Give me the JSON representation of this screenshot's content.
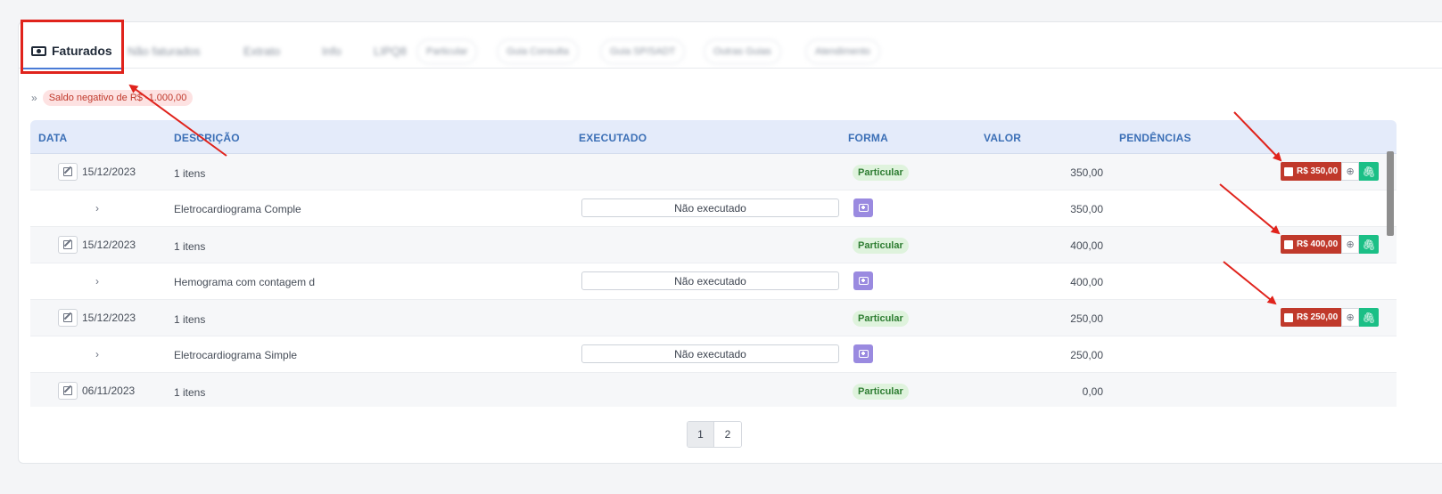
{
  "tabs": {
    "active_label": "Faturados",
    "others": [
      "Não faturados",
      "Extrato",
      "Info",
      "LIPQ8",
      "Particular",
      "Guia Consulta",
      "Guia SP/SADT",
      "Outras Guias",
      "Atendimento"
    ]
  },
  "saldo": {
    "prefix": "»",
    "text": "Saldo negativo de R$ -1.000,00"
  },
  "table": {
    "headers": {
      "data": "DATA",
      "descricao": "DESCRIÇÃO",
      "executado": "EXECUTADO",
      "forma": "FORMA",
      "valor": "VALOR",
      "pendencias": "PENDÊNCIAS"
    },
    "groups": [
      {
        "date": "15/12/2023",
        "desc": "1 itens",
        "forma": "Particular",
        "valor": "350,00",
        "pendencia": "R$ 350,00",
        "item": {
          "desc": "Eletrocardiograma Comple",
          "exec": "Não executado",
          "valor": "350,00"
        }
      },
      {
        "date": "15/12/2023",
        "desc": "1 itens",
        "forma": "Particular",
        "valor": "400,00",
        "pendencia": "R$ 400,00",
        "item": {
          "desc": "Hemograma com contagem d",
          "exec": "Não executado",
          "valor": "400,00"
        }
      },
      {
        "date": "15/12/2023",
        "desc": "1 itens",
        "forma": "Particular",
        "valor": "250,00",
        "pendencia": "R$ 250,00",
        "item": {
          "desc": "Eletrocardiograma Simple",
          "exec": "Não executado",
          "valor": "250,00"
        }
      },
      {
        "date": "06/11/2023",
        "desc": "1 itens",
        "forma": "Particular",
        "valor": "0,00"
      }
    ]
  },
  "pagination": {
    "pages": [
      "1",
      "2"
    ],
    "current": "1"
  },
  "colors": {
    "accent": "#4a7bd6",
    "danger": "#c0392b",
    "success": "#1bbf86",
    "annotation": "#e0231c"
  }
}
